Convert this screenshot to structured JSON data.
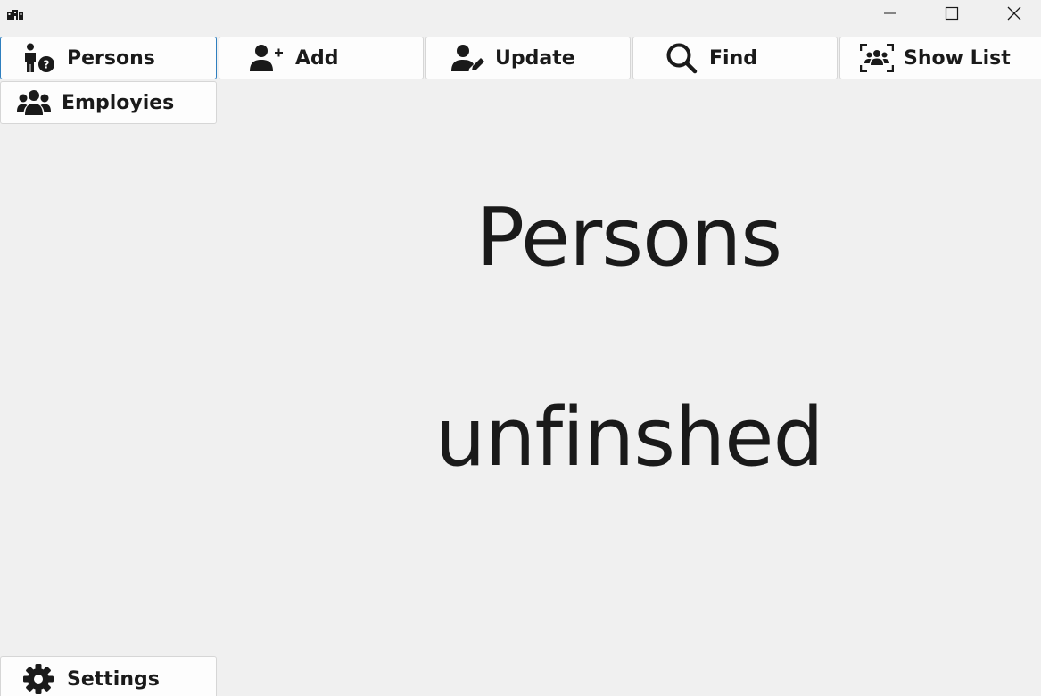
{
  "window": {
    "app_icon": "app-logo-icon",
    "controls": {
      "minimize_icon": "minimize-icon",
      "maximize_icon": "maximize-icon",
      "close_icon": "close-icon"
    }
  },
  "nav": {
    "persons": {
      "label": "Persons",
      "icon": "person-question-icon",
      "active": true
    },
    "add": {
      "label": "Add",
      "icon": "user-plus-icon"
    },
    "update": {
      "label": "Update",
      "icon": "user-edit-icon"
    },
    "find": {
      "label": "Find",
      "icon": "search-icon"
    },
    "show_list": {
      "label": "Show List",
      "icon": "group-scan-icon"
    },
    "employies": {
      "label": "Employies",
      "icon": "users-icon"
    },
    "settings": {
      "label": "Settings",
      "icon": "gear-icon"
    }
  },
  "content": {
    "title": "Persons",
    "subtitle": "unfinshed"
  },
  "colors": {
    "background": "#f0f0f0",
    "button_bg": "#fdfdfd",
    "active_border": "#2f7fbf",
    "text": "#1a1a1a"
  }
}
